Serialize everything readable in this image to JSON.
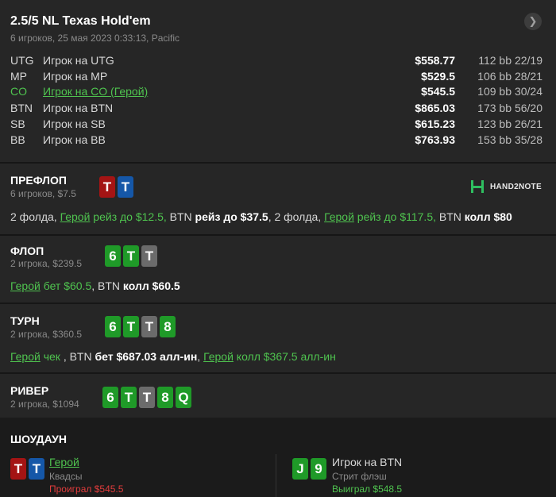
{
  "header": {
    "title": "2.5/5 NL Texas Hold'em",
    "subtitle": "6 игроков, 25 мая 2023 0:33:13, Pacific",
    "nav_icon": "chevron-right-icon"
  },
  "players": [
    {
      "pos": "UTG",
      "name": "Игрок на UTG",
      "stack": "$558.77",
      "bb": "112 bb",
      "sessions": "22/19",
      "hero": false
    },
    {
      "pos": "MP",
      "name": "Игрок на MP",
      "stack": "$529.5",
      "bb": "106 bb",
      "sessions": "28/21",
      "hero": false
    },
    {
      "pos": "CO",
      "name": "Игрок на CO (Герой)",
      "stack": "$545.5",
      "bb": "109 bb",
      "sessions": "30/24",
      "hero": true
    },
    {
      "pos": "BTN",
      "name": "Игрок на BTN",
      "stack": "$865.03",
      "bb": "173 bb",
      "sessions": "56/20",
      "hero": false
    },
    {
      "pos": "SB",
      "name": "Игрок на SB",
      "stack": "$615.23",
      "bb": "123 bb",
      "sessions": "26/21",
      "hero": false
    },
    {
      "pos": "BB",
      "name": "Игрок на BB",
      "stack": "$763.93",
      "bb": "153 bb",
      "sessions": "35/28",
      "hero": false
    }
  ],
  "separator_dot": "·",
  "logo_text": "HAND2NOTE",
  "preflop": {
    "title": "ПРЕФЛОП",
    "sub": "6 игроков, $7.5",
    "cards": [
      "T",
      "T"
    ],
    "a1": "2 фолда, ",
    "a2": "Герой",
    "a3": " рейз до $12.5, ",
    "a4": "BTN ",
    "a5": "рейз до $37.5",
    "a6": ", 2 фолда, ",
    "a7": "Герой",
    "a8": " рейз до $117.5, ",
    "a9": "BTN ",
    "a10": "колл $80"
  },
  "flop": {
    "title": "ФЛОП",
    "sub": "2 игрока, $239.5",
    "cards": [
      "6",
      "T",
      "T"
    ],
    "a1": "Герой",
    "a2": " бет $60.5",
    "a3": ", BTN ",
    "a4": "колл $60.5"
  },
  "turn": {
    "title": "ТУРН",
    "sub": "2 игрока, $360.5",
    "cards": [
      "6",
      "T",
      "T",
      "8"
    ],
    "a1": "Герой",
    "a2": " чек ",
    "a3": ", BTN ",
    "a4": "бет $687.03 алл-ин",
    "a5": ", ",
    "a6": "Герой",
    "a7": " колл $367.5 алл-ин"
  },
  "river": {
    "title": "РИВЕР",
    "sub": "2 игрока, $1094",
    "cards": [
      "6",
      "T",
      "T",
      "8",
      "Q"
    ]
  },
  "showdown": {
    "title": "ШОУДАУН",
    "hero": {
      "cards": [
        "T",
        "T"
      ],
      "name": "Герой",
      "hand": "Квадсы",
      "result": "Проиграл $545.5"
    },
    "villain": {
      "cards": [
        "J",
        "9"
      ],
      "name": "Игрок на BTN",
      "hand": "Стрит флэш",
      "result": "Выиграл $548.5"
    }
  },
  "colors": {
    "hero_green": "#4fc34f",
    "lost_red": "#e23c3c",
    "card_red": "#a41414",
    "card_blue": "#1557a8",
    "card_green": "#1f9a28",
    "card_gray": "#6b6b6b"
  }
}
